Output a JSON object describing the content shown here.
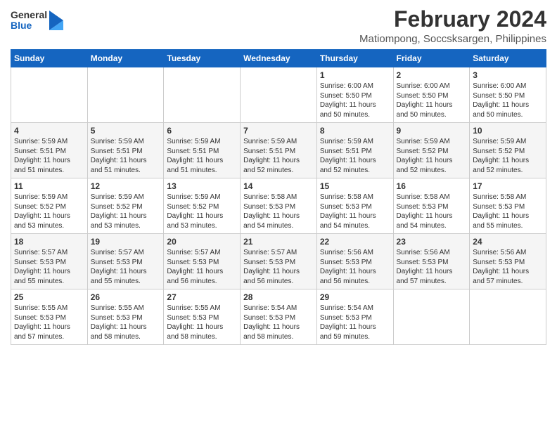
{
  "logo": {
    "general": "General",
    "blue": "Blue"
  },
  "title": "February 2024",
  "subtitle": "Matiompong, Soccsksargen, Philippines",
  "headers": [
    "Sunday",
    "Monday",
    "Tuesday",
    "Wednesday",
    "Thursday",
    "Friday",
    "Saturday"
  ],
  "weeks": [
    [
      {
        "day": "",
        "text": ""
      },
      {
        "day": "",
        "text": ""
      },
      {
        "day": "",
        "text": ""
      },
      {
        "day": "",
        "text": ""
      },
      {
        "day": "1",
        "text": "Sunrise: 6:00 AM\nSunset: 5:50 PM\nDaylight: 11 hours\nand 50 minutes."
      },
      {
        "day": "2",
        "text": "Sunrise: 6:00 AM\nSunset: 5:50 PM\nDaylight: 11 hours\nand 50 minutes."
      },
      {
        "day": "3",
        "text": "Sunrise: 6:00 AM\nSunset: 5:50 PM\nDaylight: 11 hours\nand 50 minutes."
      }
    ],
    [
      {
        "day": "4",
        "text": "Sunrise: 5:59 AM\nSunset: 5:51 PM\nDaylight: 11 hours\nand 51 minutes."
      },
      {
        "day": "5",
        "text": "Sunrise: 5:59 AM\nSunset: 5:51 PM\nDaylight: 11 hours\nand 51 minutes."
      },
      {
        "day": "6",
        "text": "Sunrise: 5:59 AM\nSunset: 5:51 PM\nDaylight: 11 hours\nand 51 minutes."
      },
      {
        "day": "7",
        "text": "Sunrise: 5:59 AM\nSunset: 5:51 PM\nDaylight: 11 hours\nand 52 minutes."
      },
      {
        "day": "8",
        "text": "Sunrise: 5:59 AM\nSunset: 5:51 PM\nDaylight: 11 hours\nand 52 minutes."
      },
      {
        "day": "9",
        "text": "Sunrise: 5:59 AM\nSunset: 5:52 PM\nDaylight: 11 hours\nand 52 minutes."
      },
      {
        "day": "10",
        "text": "Sunrise: 5:59 AM\nSunset: 5:52 PM\nDaylight: 11 hours\nand 52 minutes."
      }
    ],
    [
      {
        "day": "11",
        "text": "Sunrise: 5:59 AM\nSunset: 5:52 PM\nDaylight: 11 hours\nand 53 minutes."
      },
      {
        "day": "12",
        "text": "Sunrise: 5:59 AM\nSunset: 5:52 PM\nDaylight: 11 hours\nand 53 minutes."
      },
      {
        "day": "13",
        "text": "Sunrise: 5:59 AM\nSunset: 5:52 PM\nDaylight: 11 hours\nand 53 minutes."
      },
      {
        "day": "14",
        "text": "Sunrise: 5:58 AM\nSunset: 5:53 PM\nDaylight: 11 hours\nand 54 minutes."
      },
      {
        "day": "15",
        "text": "Sunrise: 5:58 AM\nSunset: 5:53 PM\nDaylight: 11 hours\nand 54 minutes."
      },
      {
        "day": "16",
        "text": "Sunrise: 5:58 AM\nSunset: 5:53 PM\nDaylight: 11 hours\nand 54 minutes."
      },
      {
        "day": "17",
        "text": "Sunrise: 5:58 AM\nSunset: 5:53 PM\nDaylight: 11 hours\nand 55 minutes."
      }
    ],
    [
      {
        "day": "18",
        "text": "Sunrise: 5:57 AM\nSunset: 5:53 PM\nDaylight: 11 hours\nand 55 minutes."
      },
      {
        "day": "19",
        "text": "Sunrise: 5:57 AM\nSunset: 5:53 PM\nDaylight: 11 hours\nand 55 minutes."
      },
      {
        "day": "20",
        "text": "Sunrise: 5:57 AM\nSunset: 5:53 PM\nDaylight: 11 hours\nand 56 minutes."
      },
      {
        "day": "21",
        "text": "Sunrise: 5:57 AM\nSunset: 5:53 PM\nDaylight: 11 hours\nand 56 minutes."
      },
      {
        "day": "22",
        "text": "Sunrise: 5:56 AM\nSunset: 5:53 PM\nDaylight: 11 hours\nand 56 minutes."
      },
      {
        "day": "23",
        "text": "Sunrise: 5:56 AM\nSunset: 5:53 PM\nDaylight: 11 hours\nand 57 minutes."
      },
      {
        "day": "24",
        "text": "Sunrise: 5:56 AM\nSunset: 5:53 PM\nDaylight: 11 hours\nand 57 minutes."
      }
    ],
    [
      {
        "day": "25",
        "text": "Sunrise: 5:55 AM\nSunset: 5:53 PM\nDaylight: 11 hours\nand 57 minutes."
      },
      {
        "day": "26",
        "text": "Sunrise: 5:55 AM\nSunset: 5:53 PM\nDaylight: 11 hours\nand 58 minutes."
      },
      {
        "day": "27",
        "text": "Sunrise: 5:55 AM\nSunset: 5:53 PM\nDaylight: 11 hours\nand 58 minutes."
      },
      {
        "day": "28",
        "text": "Sunrise: 5:54 AM\nSunset: 5:53 PM\nDaylight: 11 hours\nand 58 minutes."
      },
      {
        "day": "29",
        "text": "Sunrise: 5:54 AM\nSunset: 5:53 PM\nDaylight: 11 hours\nand 59 minutes."
      },
      {
        "day": "",
        "text": ""
      },
      {
        "day": "",
        "text": ""
      }
    ]
  ]
}
